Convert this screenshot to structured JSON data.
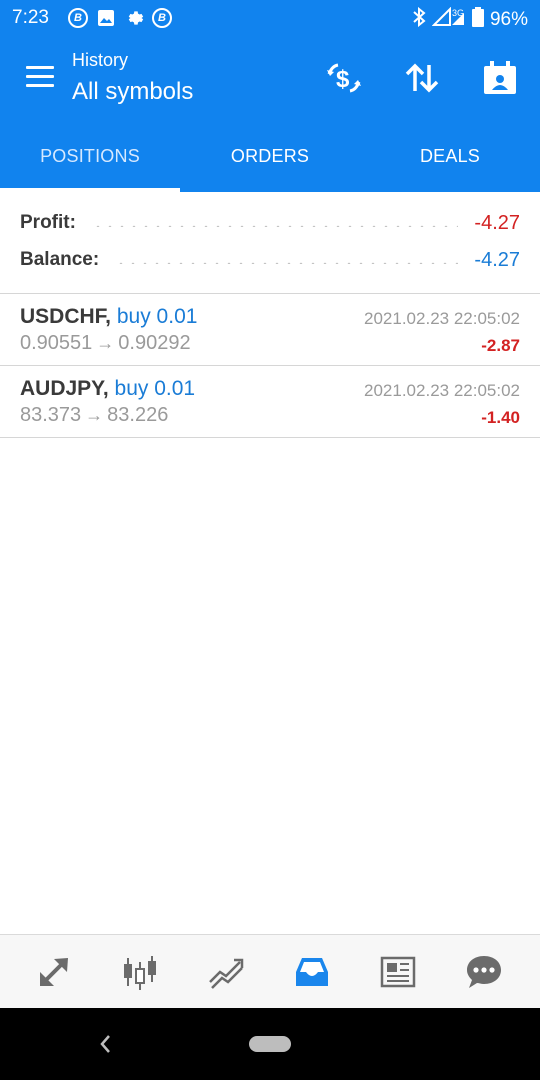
{
  "status_bar": {
    "time": "7:23",
    "battery": "96%",
    "network": "3G"
  },
  "app_bar": {
    "title_small": "History",
    "title_big": "All symbols"
  },
  "tabs": [
    {
      "label": "POSITIONS",
      "active": true
    },
    {
      "label": "ORDERS",
      "active": false
    },
    {
      "label": "DEALS",
      "active": false
    }
  ],
  "summary": {
    "profit_label": "Profit:",
    "profit_value": "-4.27",
    "balance_label": "Balance:",
    "balance_value": "-4.27"
  },
  "positions": [
    {
      "symbol": "USDCHF,",
      "type": "buy 0.01",
      "open_price": "0.90551",
      "arrow": "→",
      "close_price": "0.90292",
      "time": "2021.02.23 22:05:02",
      "profit": "-2.87"
    },
    {
      "symbol": "AUDJPY,",
      "type": "buy 0.01",
      "open_price": "83.373",
      "arrow": "→",
      "close_price": "83.226",
      "time": "2021.02.23 22:05:02",
      "profit": "-1.40"
    }
  ],
  "bottom_nav": [
    {
      "icon": "quotes-icon",
      "active": false
    },
    {
      "icon": "chart-icon",
      "active": false
    },
    {
      "icon": "trade-icon",
      "active": false
    },
    {
      "icon": "history-icon",
      "active": true
    },
    {
      "icon": "news-icon",
      "active": false
    },
    {
      "icon": "chat-icon",
      "active": false
    }
  ],
  "colors": {
    "primary": "#1183ee",
    "loss": "#d32222",
    "accent_blue": "#1a7cd6",
    "muted": "#9a9a9a"
  }
}
